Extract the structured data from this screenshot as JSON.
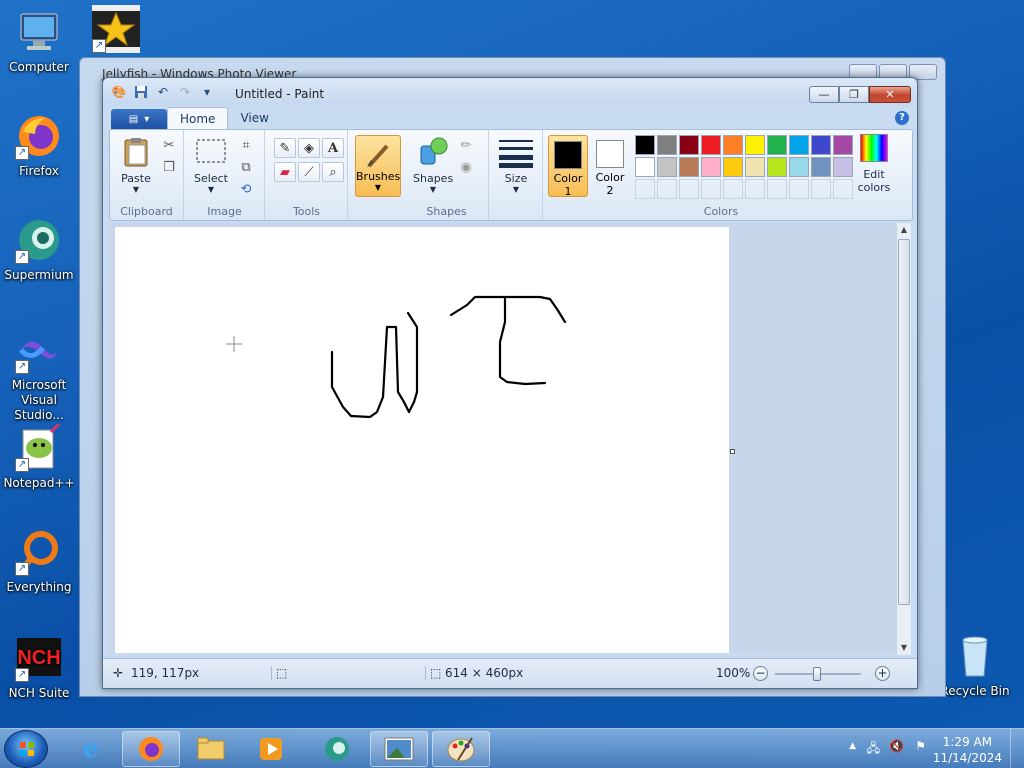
{
  "desktop": {
    "icons": [
      {
        "label": "Computer"
      },
      {
        "label": "Firefox"
      },
      {
        "label": "Supermium"
      },
      {
        "label": "Microsoft Visual Studio..."
      },
      {
        "label": "Notepad++"
      },
      {
        "label": "Everything"
      },
      {
        "label": "NCH Suite"
      },
      {
        "label": "Recycle Bin"
      }
    ]
  },
  "background_window": {
    "title": "Jellyfish - Windows Photo Viewer"
  },
  "paint": {
    "title": "Untitled - Paint",
    "tabs": [
      "Home",
      "View"
    ],
    "groups": {
      "clipboard": {
        "label": "Clipboard",
        "paste": "Paste"
      },
      "image": {
        "label": "Image",
        "select": "Select"
      },
      "tools": {
        "label": "Tools"
      },
      "shapes": {
        "label": "Shapes",
        "brushes": "Brushes",
        "shapes_btn": "Shapes",
        "size": "Size"
      },
      "colors": {
        "label": "Colors",
        "color1": "Color\n1",
        "color2": "Color\n2",
        "edit": "Edit colors"
      }
    },
    "color1_value": "#000000",
    "color2_value": "#ffffff",
    "palette_row1": [
      "#000000",
      "#7f7f7f",
      "#880015",
      "#ed1c24",
      "#ff7f27",
      "#fff200",
      "#22b14c",
      "#00a2e8",
      "#3f48cc",
      "#a349a4"
    ],
    "palette_row2": [
      "#ffffff",
      "#c3c3c3",
      "#b97a57",
      "#ffaec9",
      "#ffc90e",
      "#efe4b0",
      "#b5e61d",
      "#99d9ea",
      "#7092be",
      "#c8bfe7"
    ],
    "status": {
      "cursor_pos": "119, 117px",
      "canvas_size": "614 × 460px",
      "zoom": "100%"
    }
  },
  "taskbar": {
    "time": "1:29 AM",
    "date": "11/14/2024"
  }
}
